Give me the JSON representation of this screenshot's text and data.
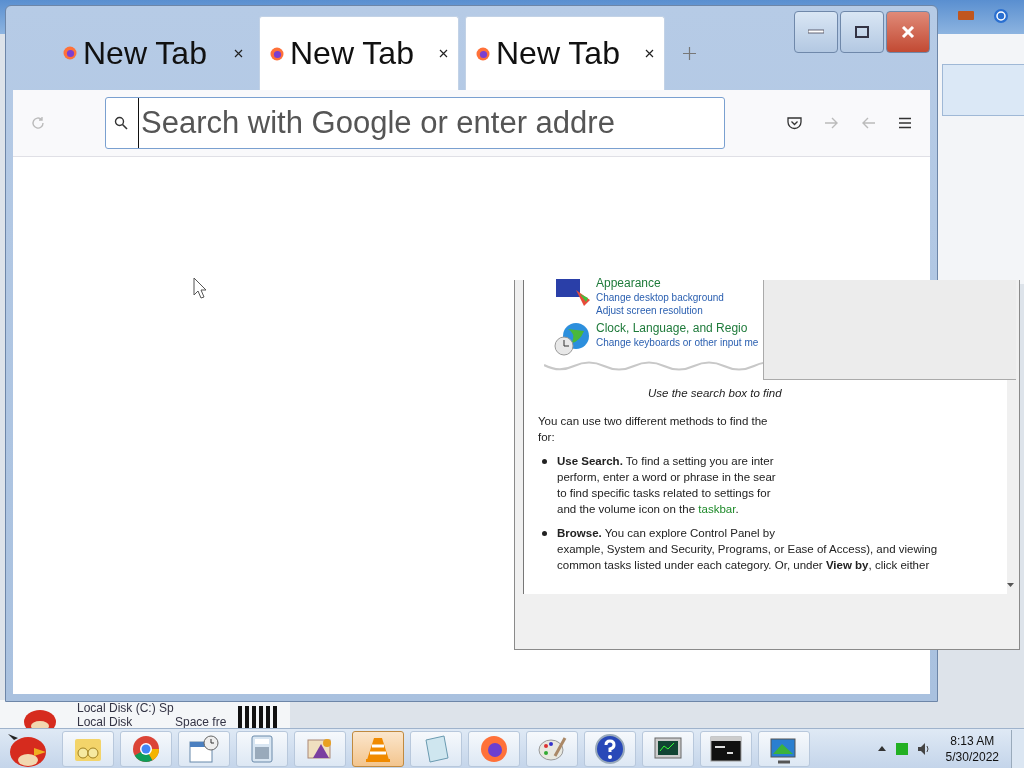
{
  "browser": {
    "tabs": [
      {
        "label": "New Tab",
        "selected": false
      },
      {
        "label": "New Tab",
        "selected": true
      },
      {
        "label": "New Tab",
        "selected": true
      }
    ],
    "address_bar": {
      "placeholder": "Search with Google or enter addre"
    }
  },
  "explorer_strip": {
    "line_1": "Local Disk (C:) Sp",
    "line_2": "Local Disk",
    "line_3": "Space fre"
  },
  "help_window": {
    "categories": [
      {
        "title": "Appearance",
        "kind": "monitor",
        "links": [
          "Change desktop background",
          "Adjust screen resolution"
        ]
      },
      {
        "title": "Clock, Language, and Regio",
        "kind": "globe",
        "links": [
          "Change keyboards or other input me"
        ]
      }
    ],
    "caption": "Use the search box to find",
    "intro": [
      "You can use two different methods to find the",
      "for:"
    ],
    "bullets": [
      {
        "lines": [
          {
            "text": "**Use Search.** To find a setting you are inter"
          },
          {
            "text": "perform, enter a word or phrase in the sear"
          },
          {
            "text": "to find specific tasks related to settings for"
          },
          {
            "text": "and the volume icon on the ",
            "link": "taskbar",
            "tail": "."
          }
        ]
      },
      {
        "lines": [
          {
            "text": "**Browse.** You can explore Control Panel by"
          },
          {
            "text": "example, System and Security, Programs, or Ease of Access), and viewing"
          },
          {
            "text": "common tasks listed under each category. Or, under **View by**, click either"
          }
        ]
      }
    ]
  },
  "taskbar": {
    "apps": [
      {
        "kind": "folder",
        "selected": false
      },
      {
        "kind": "chrome",
        "selected": false
      },
      {
        "kind": "calendar",
        "selected": false
      },
      {
        "kind": "calculator",
        "selected": false
      },
      {
        "kind": "media",
        "selected": false
      },
      {
        "kind": "vlc",
        "selected": true
      },
      {
        "kind": "notepad",
        "selected": false
      },
      {
        "kind": "firefox",
        "selected": false
      },
      {
        "kind": "paint",
        "selected": false
      },
      {
        "kind": "help",
        "selected": false
      },
      {
        "kind": "monitor",
        "selected": false
      },
      {
        "kind": "terminal",
        "selected": false
      },
      {
        "kind": "display",
        "selected": false
      }
    ],
    "clock": {
      "time": "8:13 AM",
      "date": "5/30/2022"
    }
  }
}
